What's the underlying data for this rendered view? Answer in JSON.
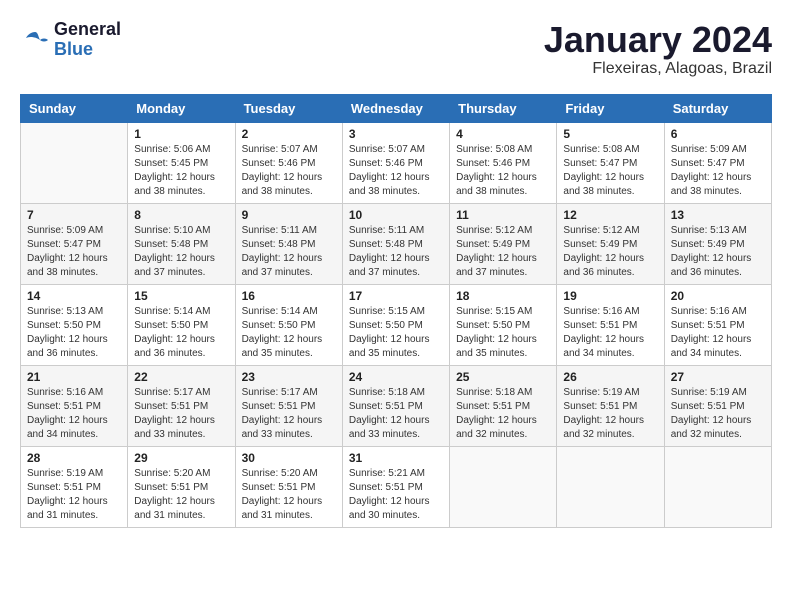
{
  "header": {
    "logo_general": "General",
    "logo_blue": "Blue",
    "month_year": "January 2024",
    "location": "Flexeiras, Alagoas, Brazil"
  },
  "days_of_week": [
    "Sunday",
    "Monday",
    "Tuesday",
    "Wednesday",
    "Thursday",
    "Friday",
    "Saturday"
  ],
  "weeks": [
    [
      {
        "day": "",
        "sunrise": "",
        "sunset": "",
        "daylight": ""
      },
      {
        "day": "1",
        "sunrise": "Sunrise: 5:06 AM",
        "sunset": "Sunset: 5:45 PM",
        "daylight": "Daylight: 12 hours and 38 minutes."
      },
      {
        "day": "2",
        "sunrise": "Sunrise: 5:07 AM",
        "sunset": "Sunset: 5:46 PM",
        "daylight": "Daylight: 12 hours and 38 minutes."
      },
      {
        "day": "3",
        "sunrise": "Sunrise: 5:07 AM",
        "sunset": "Sunset: 5:46 PM",
        "daylight": "Daylight: 12 hours and 38 minutes."
      },
      {
        "day": "4",
        "sunrise": "Sunrise: 5:08 AM",
        "sunset": "Sunset: 5:46 PM",
        "daylight": "Daylight: 12 hours and 38 minutes."
      },
      {
        "day": "5",
        "sunrise": "Sunrise: 5:08 AM",
        "sunset": "Sunset: 5:47 PM",
        "daylight": "Daylight: 12 hours and 38 minutes."
      },
      {
        "day": "6",
        "sunrise": "Sunrise: 5:09 AM",
        "sunset": "Sunset: 5:47 PM",
        "daylight": "Daylight: 12 hours and 38 minutes."
      }
    ],
    [
      {
        "day": "7",
        "sunrise": "Sunrise: 5:09 AM",
        "sunset": "Sunset: 5:47 PM",
        "daylight": "Daylight: 12 hours and 38 minutes."
      },
      {
        "day": "8",
        "sunrise": "Sunrise: 5:10 AM",
        "sunset": "Sunset: 5:48 PM",
        "daylight": "Daylight: 12 hours and 37 minutes."
      },
      {
        "day": "9",
        "sunrise": "Sunrise: 5:11 AM",
        "sunset": "Sunset: 5:48 PM",
        "daylight": "Daylight: 12 hours and 37 minutes."
      },
      {
        "day": "10",
        "sunrise": "Sunrise: 5:11 AM",
        "sunset": "Sunset: 5:48 PM",
        "daylight": "Daylight: 12 hours and 37 minutes."
      },
      {
        "day": "11",
        "sunrise": "Sunrise: 5:12 AM",
        "sunset": "Sunset: 5:49 PM",
        "daylight": "Daylight: 12 hours and 37 minutes."
      },
      {
        "day": "12",
        "sunrise": "Sunrise: 5:12 AM",
        "sunset": "Sunset: 5:49 PM",
        "daylight": "Daylight: 12 hours and 36 minutes."
      },
      {
        "day": "13",
        "sunrise": "Sunrise: 5:13 AM",
        "sunset": "Sunset: 5:49 PM",
        "daylight": "Daylight: 12 hours and 36 minutes."
      }
    ],
    [
      {
        "day": "14",
        "sunrise": "Sunrise: 5:13 AM",
        "sunset": "Sunset: 5:50 PM",
        "daylight": "Daylight: 12 hours and 36 minutes."
      },
      {
        "day": "15",
        "sunrise": "Sunrise: 5:14 AM",
        "sunset": "Sunset: 5:50 PM",
        "daylight": "Daylight: 12 hours and 36 minutes."
      },
      {
        "day": "16",
        "sunrise": "Sunrise: 5:14 AM",
        "sunset": "Sunset: 5:50 PM",
        "daylight": "Daylight: 12 hours and 35 minutes."
      },
      {
        "day": "17",
        "sunrise": "Sunrise: 5:15 AM",
        "sunset": "Sunset: 5:50 PM",
        "daylight": "Daylight: 12 hours and 35 minutes."
      },
      {
        "day": "18",
        "sunrise": "Sunrise: 5:15 AM",
        "sunset": "Sunset: 5:50 PM",
        "daylight": "Daylight: 12 hours and 35 minutes."
      },
      {
        "day": "19",
        "sunrise": "Sunrise: 5:16 AM",
        "sunset": "Sunset: 5:51 PM",
        "daylight": "Daylight: 12 hours and 34 minutes."
      },
      {
        "day": "20",
        "sunrise": "Sunrise: 5:16 AM",
        "sunset": "Sunset: 5:51 PM",
        "daylight": "Daylight: 12 hours and 34 minutes."
      }
    ],
    [
      {
        "day": "21",
        "sunrise": "Sunrise: 5:16 AM",
        "sunset": "Sunset: 5:51 PM",
        "daylight": "Daylight: 12 hours and 34 minutes."
      },
      {
        "day": "22",
        "sunrise": "Sunrise: 5:17 AM",
        "sunset": "Sunset: 5:51 PM",
        "daylight": "Daylight: 12 hours and 33 minutes."
      },
      {
        "day": "23",
        "sunrise": "Sunrise: 5:17 AM",
        "sunset": "Sunset: 5:51 PM",
        "daylight": "Daylight: 12 hours and 33 minutes."
      },
      {
        "day": "24",
        "sunrise": "Sunrise: 5:18 AM",
        "sunset": "Sunset: 5:51 PM",
        "daylight": "Daylight: 12 hours and 33 minutes."
      },
      {
        "day": "25",
        "sunrise": "Sunrise: 5:18 AM",
        "sunset": "Sunset: 5:51 PM",
        "daylight": "Daylight: 12 hours and 32 minutes."
      },
      {
        "day": "26",
        "sunrise": "Sunrise: 5:19 AM",
        "sunset": "Sunset: 5:51 PM",
        "daylight": "Daylight: 12 hours and 32 minutes."
      },
      {
        "day": "27",
        "sunrise": "Sunrise: 5:19 AM",
        "sunset": "Sunset: 5:51 PM",
        "daylight": "Daylight: 12 hours and 32 minutes."
      }
    ],
    [
      {
        "day": "28",
        "sunrise": "Sunrise: 5:19 AM",
        "sunset": "Sunset: 5:51 PM",
        "daylight": "Daylight: 12 hours and 31 minutes."
      },
      {
        "day": "29",
        "sunrise": "Sunrise: 5:20 AM",
        "sunset": "Sunset: 5:51 PM",
        "daylight": "Daylight: 12 hours and 31 minutes."
      },
      {
        "day": "30",
        "sunrise": "Sunrise: 5:20 AM",
        "sunset": "Sunset: 5:51 PM",
        "daylight": "Daylight: 12 hours and 31 minutes."
      },
      {
        "day": "31",
        "sunrise": "Sunrise: 5:21 AM",
        "sunset": "Sunset: 5:51 PM",
        "daylight": "Daylight: 12 hours and 30 minutes."
      },
      {
        "day": "",
        "sunrise": "",
        "sunset": "",
        "daylight": ""
      },
      {
        "day": "",
        "sunrise": "",
        "sunset": "",
        "daylight": ""
      },
      {
        "day": "",
        "sunrise": "",
        "sunset": "",
        "daylight": ""
      }
    ]
  ]
}
